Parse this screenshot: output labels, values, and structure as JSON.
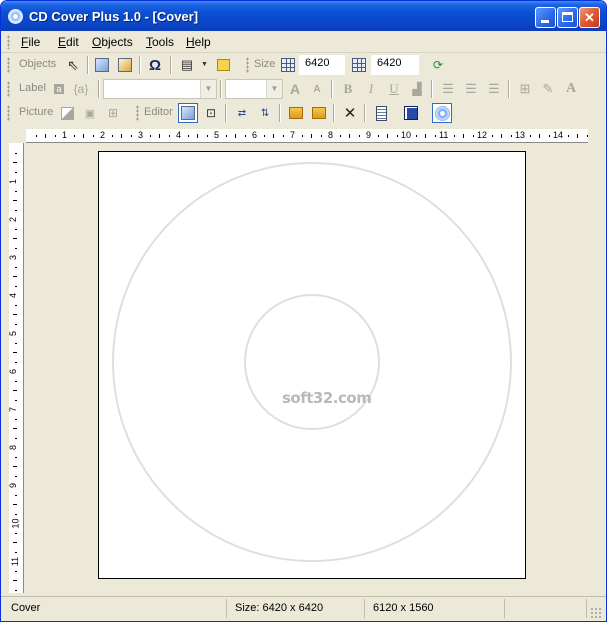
{
  "window": {
    "title": "CD Cover Plus 1.0 - [Cover]"
  },
  "menu": [
    {
      "label": "File",
      "key": "F"
    },
    {
      "label": "Edit",
      "key": "E"
    },
    {
      "label": "Objects",
      "key": "O"
    },
    {
      "label": "Tools",
      "key": "T"
    },
    {
      "label": "Help",
      "key": "H"
    }
  ],
  "toolbar_objects": {
    "label": "Objects",
    "size_label": "Size",
    "width_value": "6420",
    "height_value": "6420"
  },
  "toolbar_label": {
    "label": "Label",
    "font_combo": "",
    "size_combo": ""
  },
  "toolbar_picture": {
    "label": "Picture",
    "editor_label": "Editor"
  },
  "icons": {
    "omega": "Ω",
    "bold": "B",
    "italic": "I",
    "underline": "U",
    "close_x": "✕",
    "pen": "✎",
    "font_grow": "A",
    "font_shrink": "A",
    "text_a": "A",
    "var": "{a}"
  },
  "canvas": {
    "watermark": "soft32.com"
  },
  "status": {
    "mode": "Cover",
    "size": "Size: 6420 x 6420",
    "dims": "6120 x 1560"
  },
  "ruler": {
    "h_numbers": [
      "1",
      "2",
      "3",
      "4",
      "5",
      "6",
      "7",
      "8",
      "9",
      "10",
      "11",
      "12",
      "13",
      "14"
    ],
    "v_numbers": [
      "1",
      "2",
      "3",
      "4",
      "5",
      "6",
      "7",
      "8",
      "9",
      "10",
      "11"
    ]
  }
}
